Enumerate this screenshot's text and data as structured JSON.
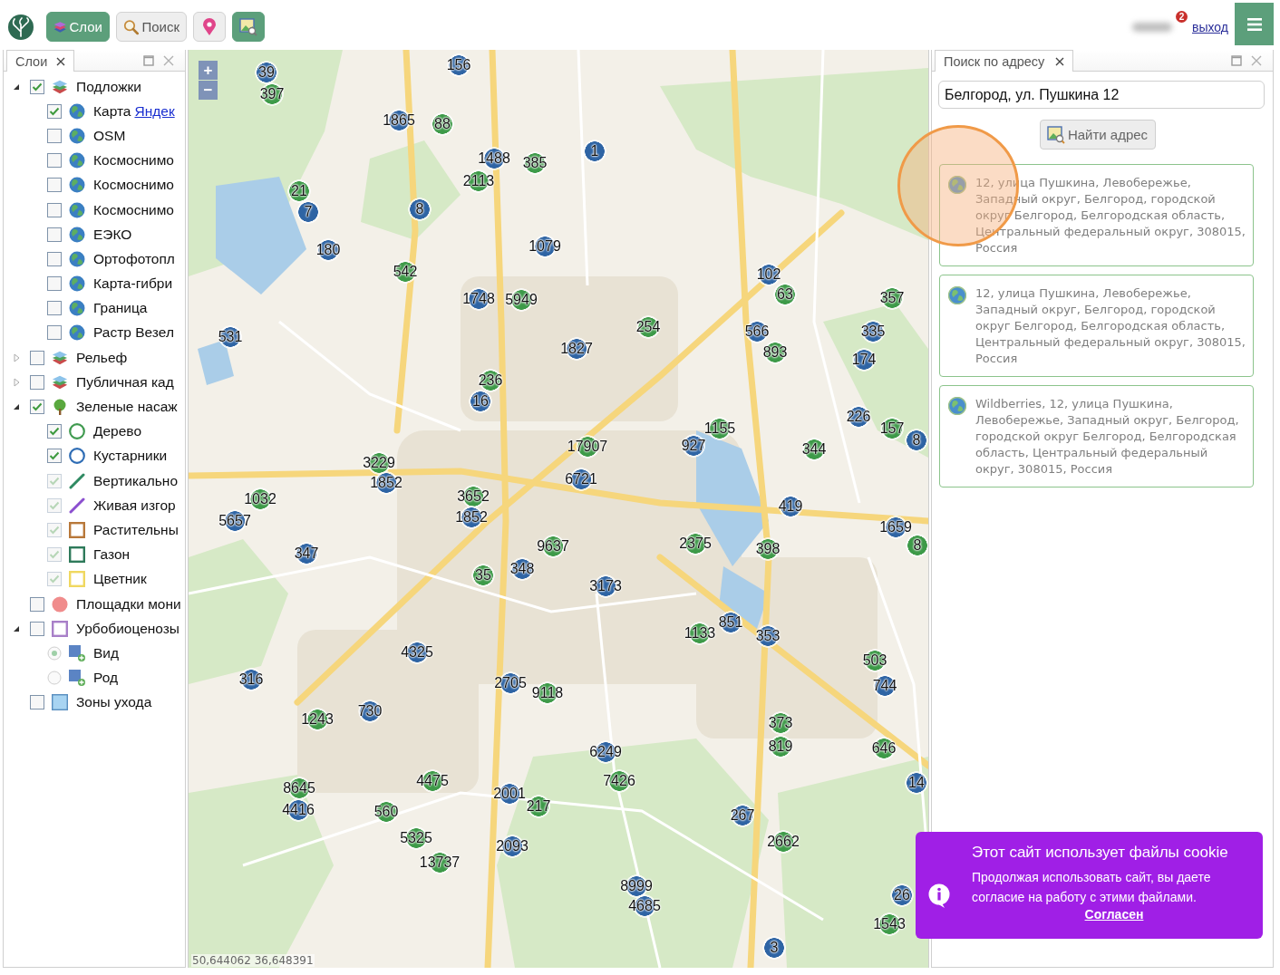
{
  "toolbar": {
    "buttons": [
      {
        "kind": "layers",
        "label": "Слои",
        "selected": true
      },
      {
        "kind": "search",
        "label": "Поиск",
        "selected": false
      },
      {
        "kind": "pin",
        "selected": false
      },
      {
        "kind": "image-search",
        "selected": true
      }
    ],
    "badge": "2",
    "logout": "выход"
  },
  "layers_panel": {
    "tab": "Слои",
    "tree": [
      {
        "label": "Подложки",
        "expanded": true,
        "checked": true,
        "disabled": false,
        "kind": "layers",
        "children": [
          {
            "label": "Карта",
            "link": "Яндек",
            "checked": true,
            "disabled": false,
            "kind": "globe"
          },
          {
            "label": "OSM",
            "checked": false,
            "disabled": false,
            "kind": "globe"
          },
          {
            "label": "Космоснимо",
            "checked": false,
            "disabled": false,
            "kind": "globe"
          },
          {
            "label": "Космоснимо",
            "checked": false,
            "disabled": false,
            "kind": "globe"
          },
          {
            "label": "Космоснимо",
            "checked": false,
            "disabled": false,
            "kind": "globe"
          },
          {
            "label": "ЕЭКО",
            "checked": false,
            "disabled": false,
            "kind": "globe"
          },
          {
            "label": "Ортофотопл",
            "checked": false,
            "disabled": false,
            "kind": "globe"
          },
          {
            "label": "Карта-гибри",
            "checked": false,
            "disabled": false,
            "kind": "globe"
          },
          {
            "label": "Граница",
            "checked": false,
            "disabled": false,
            "kind": "globe"
          },
          {
            "label": "Растр Везел",
            "checked": false,
            "disabled": false,
            "kind": "globe"
          }
        ]
      },
      {
        "label": "Рельеф",
        "expanded": false,
        "checked": false,
        "disabled": false,
        "kind": "layers"
      },
      {
        "label": "Публичная кад",
        "expanded": false,
        "checked": false,
        "disabled": false,
        "kind": "layers"
      },
      {
        "label": "Зеленые насаж",
        "expanded": true,
        "checked": true,
        "disabled": false,
        "kind": "tree",
        "children": [
          {
            "label": "Дерево",
            "checked": true,
            "disabled": false,
            "kind": "ring",
            "color": "#3f9a4f"
          },
          {
            "label": "Кустарники",
            "checked": true,
            "disabled": false,
            "kind": "ring",
            "color": "#2f6db5"
          },
          {
            "label": "Вертикально",
            "checked": true,
            "disabled": true,
            "kind": "line",
            "color": "#2f8a62"
          },
          {
            "label": "Живая изгор",
            "checked": true,
            "disabled": true,
            "kind": "line",
            "color": "#8b4fcf"
          },
          {
            "label": "Растительны",
            "checked": true,
            "disabled": true,
            "kind": "square",
            "color": "#b8783a"
          },
          {
            "label": "Газон",
            "checked": true,
            "disabled": true,
            "kind": "square",
            "color": "#2e7a5a"
          },
          {
            "label": "Цветник",
            "checked": true,
            "disabled": true,
            "kind": "square",
            "color": "#f0d860"
          }
        ]
      },
      {
        "label": "Площадки мони",
        "checked": false,
        "disabled": false,
        "kind": "disc",
        "color": "#f08c8c"
      },
      {
        "label": "Урбобиоценозы",
        "expanded": true,
        "checked": false,
        "disabled": false,
        "kind": "square",
        "color": "#a87fc8",
        "children": [
          {
            "label": "Вид",
            "selected": true,
            "disabled": true,
            "kind": "tileplus"
          },
          {
            "label": "Род",
            "selected": false,
            "disabled": true,
            "kind": "tileplus"
          }
        ]
      },
      {
        "label": "Зоны ухода",
        "checked": false,
        "disabled": false,
        "kind": "tile",
        "color": "#a8d4f2"
      }
    ]
  },
  "map": {
    "zoom": [
      "+",
      "−"
    ],
    "markers": [
      {
        "label": "39",
        "color": "#2e64a4"
      },
      {
        "label": "156",
        "color": "#2e64a4"
      },
      {
        "label": "397",
        "color": "#3d9a48"
      },
      {
        "label": "1865",
        "color": "#2e64a4"
      },
      {
        "label": "88",
        "color": "#3d9a48"
      },
      {
        "label": "1488",
        "color": "#2e64a4"
      },
      {
        "label": "385",
        "color": "#3d9a48"
      },
      {
        "label": "1",
        "color": "#2e64a4"
      },
      {
        "label": "21",
        "color": "#3d9a48"
      },
      {
        "label": "2113",
        "color": "#3d9a48"
      },
      {
        "label": "7",
        "color": "#2e64a4"
      },
      {
        "label": "8",
        "color": "#2e64a4"
      },
      {
        "label": "180",
        "color": "#2e64a4"
      },
      {
        "label": "1079",
        "color": "#2e64a4"
      },
      {
        "label": "542",
        "color": "#3d9a48"
      },
      {
        "label": "102",
        "color": "#2e64a4"
      },
      {
        "label": "1748",
        "color": "#2e64a4"
      },
      {
        "label": "5949",
        "color": "#3d9a48"
      },
      {
        "label": "63",
        "color": "#3d9a48"
      },
      {
        "label": "357",
        "color": "#3d9a48"
      },
      {
        "label": "531",
        "color": "#2e64a4"
      },
      {
        "label": "254",
        "color": "#3d9a48"
      },
      {
        "label": "566",
        "color": "#2e64a4"
      },
      {
        "label": "335",
        "color": "#2e64a4"
      },
      {
        "label": "1827",
        "color": "#2e64a4"
      },
      {
        "label": "893",
        "color": "#3d9a48"
      },
      {
        "label": "174",
        "color": "#2e64a4"
      },
      {
        "label": "236",
        "color": "#3d9a48"
      },
      {
        "label": "16",
        "color": "#2e64a4"
      },
      {
        "label": "1155",
        "color": "#3d9a48"
      },
      {
        "label": "226",
        "color": "#2e64a4"
      },
      {
        "label": "157",
        "color": "#3d9a48"
      },
      {
        "label": "17907",
        "color": "#3d9a48"
      },
      {
        "label": "927",
        "color": "#2e64a4"
      },
      {
        "label": "344",
        "color": "#3d9a48"
      },
      {
        "label": "8",
        "color": "#2e64a4"
      },
      {
        "label": "3229",
        "color": "#3d9a48"
      },
      {
        "label": "1852",
        "color": "#2e64a4"
      },
      {
        "label": "6721",
        "color": "#2e64a4"
      },
      {
        "label": "1032",
        "color": "#3d9a48"
      },
      {
        "label": "3652",
        "color": "#3d9a48"
      },
      {
        "label": "5657",
        "color": "#2e64a4"
      },
      {
        "label": "1852",
        "color": "#2e64a4"
      },
      {
        "label": "419",
        "color": "#2e64a4"
      },
      {
        "label": "1659",
        "color": "#2e64a4"
      },
      {
        "label": "347",
        "color": "#2e64a4"
      },
      {
        "label": "9637",
        "color": "#3d9a48"
      },
      {
        "label": "2375",
        "color": "#3d9a48"
      },
      {
        "label": "398",
        "color": "#3d9a48"
      },
      {
        "label": "8",
        "color": "#3d9a48"
      },
      {
        "label": "35",
        "color": "#3d9a48"
      },
      {
        "label": "348",
        "color": "#2e64a4"
      },
      {
        "label": "3173",
        "color": "#2e64a4"
      },
      {
        "label": "1133",
        "color": "#3d9a48"
      },
      {
        "label": "851",
        "color": "#2e64a4"
      },
      {
        "label": "353",
        "color": "#2e64a4"
      },
      {
        "label": "4325",
        "color": "#2e64a4"
      },
      {
        "label": "503",
        "color": "#3d9a48"
      },
      {
        "label": "316",
        "color": "#2e64a4"
      },
      {
        "label": "2705",
        "color": "#2e64a4"
      },
      {
        "label": "9118",
        "color": "#3d9a48"
      },
      {
        "label": "744",
        "color": "#2e64a4"
      },
      {
        "label": "1243",
        "color": "#3d9a48"
      },
      {
        "label": "730",
        "color": "#2e64a4"
      },
      {
        "label": "373",
        "color": "#3d9a48"
      },
      {
        "label": "6249",
        "color": "#2e64a4"
      },
      {
        "label": "819",
        "color": "#3d9a48"
      },
      {
        "label": "646",
        "color": "#3d9a48"
      },
      {
        "label": "8645",
        "color": "#3d9a48"
      },
      {
        "label": "4475",
        "color": "#3d9a48"
      },
      {
        "label": "2001",
        "color": "#2e64a4"
      },
      {
        "label": "7426",
        "color": "#3d9a48"
      },
      {
        "label": "14",
        "color": "#2e64a4"
      },
      {
        "label": "4416",
        "color": "#2e64a4"
      },
      {
        "label": "560",
        "color": "#3d9a48"
      },
      {
        "label": "217",
        "color": "#3d9a48"
      },
      {
        "label": "267",
        "color": "#2e64a4"
      },
      {
        "label": "5325",
        "color": "#3d9a48"
      },
      {
        "label": "2093",
        "color": "#2e64a4"
      },
      {
        "label": "2662",
        "color": "#3d9a48"
      },
      {
        "label": "13737",
        "color": "#3d9a48"
      },
      {
        "label": "8999",
        "color": "#2e64a4"
      },
      {
        "label": "4685",
        "color": "#2e64a4"
      },
      {
        "label": "26",
        "color": "#2e64a4"
      },
      {
        "label": "1543",
        "color": "#3d9a48"
      },
      {
        "label": "3",
        "color": "#2e64a4"
      }
    ],
    "coordinates": "50,644062 36,648391"
  },
  "search_panel": {
    "tab": "Поиск по адресу",
    "query": "Белгород, ул. Пушкина 12",
    "button": "Найти адрес",
    "results": [
      "12, улица Пушкина, Левобережье, Западный округ, Белгород, городской округ Белгород, Белгородская область, Центральный федеральный округ, 308015, Россия",
      "12, улица Пушкина, Левобережье, Западный округ, Белгород, городской округ Белгород, Белгородская область, Центральный федеральный округ, 308015, Россия",
      "Wildberries, 12, улица Пушкина, Левобережье, Западный округ, Белгород, городской округ Белгород, Белгородская область, Центральный федеральный округ, 308015, Россия"
    ]
  },
  "cookie_banner": {
    "title": "Этот сайт использует файлы cookie",
    "text": "Продолжая использовать сайт, вы даете согласие на работу с этими файлами.",
    "link": "Согласен"
  }
}
